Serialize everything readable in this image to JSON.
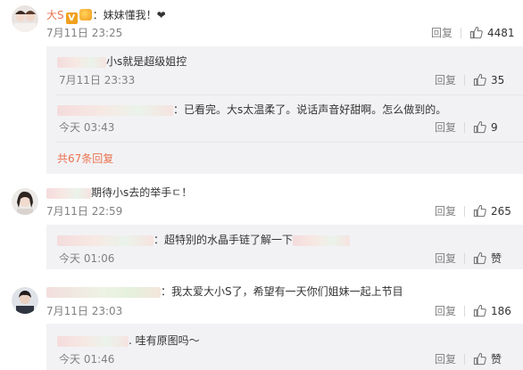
{
  "comments": [
    {
      "user": "大S",
      "text": "：妹妹懂我！❤",
      "time": "7月11日 23:25",
      "reply": "回复",
      "likes": "4481",
      "replies": [
        {
          "text": "小s就是超级姐控",
          "time": "7月11日 23:33",
          "reply": "回复",
          "likes": "35"
        },
        {
          "text": "：已看完。大s太温柔了。说话声音好甜啊。怎么做到的。",
          "time": "今天 03:43",
          "reply": "回复",
          "likes": "9"
        }
      ],
      "more_link": "共67条回复"
    },
    {
      "text": "期待小s去的举手ㄷ！",
      "time": "7月11日 22:59",
      "reply": "回复",
      "likes": "265",
      "replies": [
        {
          "text": "：超特别的水晶手链了解一下",
          "time": "今天 01:06",
          "reply": "回复",
          "likes": "赞"
        }
      ]
    },
    {
      "text": "：我太爱大小S了，希望有一天你们姐妹一起上节目",
      "time": "7月11日 23:03",
      "reply": "回复",
      "likes": "186",
      "replies": [
        {
          "text": "哇有原图吗～",
          "time": "今天 01:46",
          "reply": "回复",
          "likes": "赞"
        }
      ]
    }
  ],
  "colors": {
    "username": "#eb7350",
    "meta": "#808080",
    "reply_bg": "#f2f2f5"
  },
  "icons": [
    "thumbs-up-icon",
    "vip-badge-icon",
    "verified-v-icon"
  ]
}
